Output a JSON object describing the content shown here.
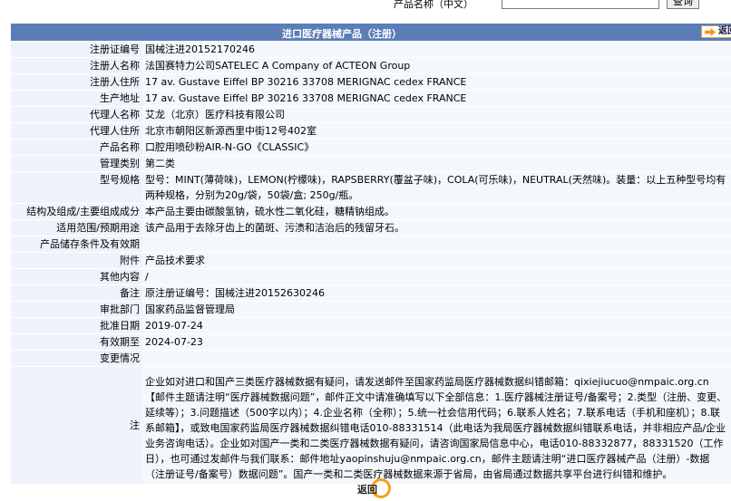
{
  "top": {
    "field_label": "产品名称（中文）",
    "search_value": "",
    "query_button": "查询"
  },
  "title": "进口医疗器械产品（注册）",
  "back_top": "返回",
  "rows": [
    {
      "k": "注册证编号",
      "v": "国械注进20152170246"
    },
    {
      "k": "注册人名称",
      "v": "法国赛特力公司SATELEC A Company of ACTEON Group"
    },
    {
      "k": "注册人住所",
      "v": "17 av. Gustave Eiffel BP 30216 33708 MERIGNAC cedex FRANCE"
    },
    {
      "k": "生产地址",
      "v": "17 av. Gustave Eiffel BP 30216 33708 MERIGNAC cedex FRANCE"
    },
    {
      "k": "代理人名称",
      "v": "艾龙（北京）医疗科技有限公司"
    },
    {
      "k": "代理人住所",
      "v": "北京市朝阳区新源西里中街12号402室"
    },
    {
      "k": "产品名称",
      "v": "口腔用喷砂粉AIR-N-GO《CLASSIC》"
    },
    {
      "k": "管理类别",
      "v": "第二类"
    },
    {
      "k": "型号规格",
      "v": "型号：MINT(薄荷味)，LEMON(柠檬味)，RAPSBERRY(覆盆子味)，COLA(可乐味)，NEUTRAL(天然味)。装量：以上五种型号均有两种规格，分别为20g/袋，50袋/盒; 250g/瓶。"
    },
    {
      "k": "结构及组成/主要组成成分",
      "v": "本产品主要由碳酸氢钠，硫水性二氧化硅，糖精钠组成。"
    },
    {
      "k": "适用范围/预期用途",
      "v": "该产品用于去除牙齿上的菌斑、污渍和洁治后的残留牙石。"
    },
    {
      "k": "产品储存条件及有效期",
      "v": ""
    },
    {
      "k": "附件",
      "v": "产品技术要求"
    },
    {
      "k": "其他内容",
      "v": "/"
    },
    {
      "k": "备注",
      "v": "原注册证编号：国械注进20152630246"
    },
    {
      "k": "审批部门",
      "v": "国家药品监督管理局"
    },
    {
      "k": "批准日期",
      "v": "2019-07-24"
    },
    {
      "k": "有效期至",
      "v": "2024-07-23"
    },
    {
      "k": "变更情况",
      "v": ""
    }
  ],
  "note": {
    "k": "注",
    "v": "企业如对进口和国产三类医疗器械数据有疑问，请发送邮件至国家药监局医疗器械数据纠错邮箱：qixiejiucuo@nmpaic.org.cn【邮件主题请注明“医疗器械数据问题”，邮件正文中请准确填写以下全部信息：1.医疗器械注册证号/备案号；2.类型（注册、变更、延续等）；3.问题描述（500字以内）；4.企业名称（全称）；5.统一社会信用代码；6.联系人姓名；7.联系电话（手机和座机）；8.联系邮箱】，或致电国家药监局医疗器械数据纠错电话010-88331514（此电话为我局医疗器械数据纠错联系电话，并非相应产品/企业业务咨询电话）。企业如对国产一类和二类医疗器械数据有疑问，请咨询国家局信息中心，电话010-88332877，88331520（工作日），也可通过发邮件与我们联系：邮件地址yaopinshuju@nmpaic.org.cn，邮件主题请注明“进口医疗器械产品（注册）-数据（注册证号/备案号）数据问题”。国产一类和二类医疗器械数据来源于省局，由省局通过数据共享平台进行纠错和维护。"
  },
  "bottom_back": "返回"
}
